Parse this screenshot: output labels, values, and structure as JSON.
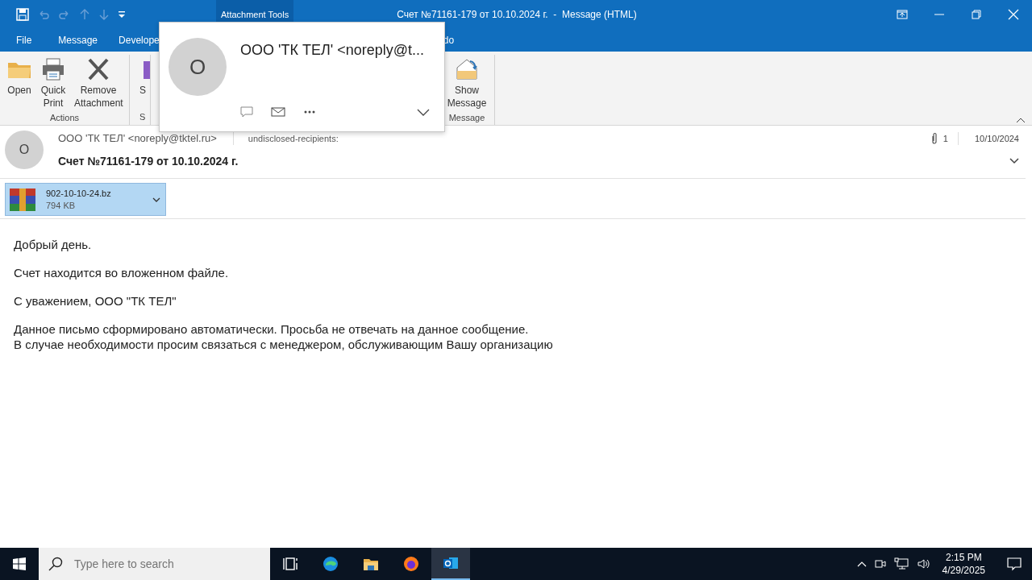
{
  "title_bar": {
    "context_tab": "Attachment Tools",
    "title": "Счет №71161-179 от 10.10.2024 г.  -  Message (HTML)"
  },
  "menu_tabs": [
    {
      "label": "File"
    },
    {
      "label": "Message"
    },
    {
      "label": "Develope"
    },
    {
      "label": "do"
    }
  ],
  "ribbon": {
    "groups": [
      {
        "label": "Actions",
        "buttons": [
          {
            "label": "Open",
            "kind": "folder"
          },
          {
            "label": "Quick Print",
            "kind": "printer"
          },
          {
            "label": "Remove Attachment",
            "kind": "remove"
          }
        ]
      },
      {
        "label": "S",
        "buttons": [
          {
            "label": "S",
            "kind": "purple"
          }
        ]
      },
      {
        "label": "Message",
        "buttons": [
          {
            "label": "Show Message",
            "kind": "envelope"
          }
        ]
      }
    ]
  },
  "contact_card": {
    "avatar_initial": "O",
    "name": "ООО 'ТК ТЕЛ' <noreply@t..."
  },
  "message": {
    "avatar_initial": "O",
    "from": "ООО 'ТК ТЕЛ' <noreply@tktel.ru>",
    "to": "undisclosed-recipients:",
    "attachment_count": "1",
    "date": "10/10/2024",
    "subject": "Счет №71161-179 от 10.10.2024 г."
  },
  "attachment": {
    "name": "902-10-10-24.bz",
    "size": "794 KB",
    "selected": true
  },
  "body": {
    "paragraphs": [
      [
        "Добрый день."
      ],
      [
        "Счет находится во вложенном файле."
      ],
      [
        "С уважением, ООО \"ТК ТЕЛ\""
      ],
      [
        "Данное письмо сформировано автоматически. Просьба не отвечать на данное сообщение.",
        "В случае необходимости просим связаться с менеджером, обслуживающим Вашу организацию"
      ]
    ]
  },
  "taskbar": {
    "search_placeholder": "Type here to search",
    "time": "2:15 PM",
    "date": "4/29/2025"
  }
}
